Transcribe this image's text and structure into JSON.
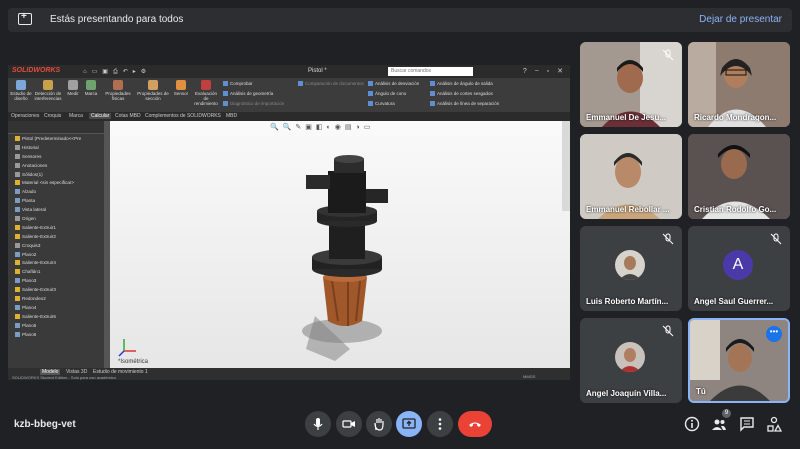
{
  "banner": {
    "text": "Estás presentando para todos",
    "stop_label": "Dejar de presentar"
  },
  "solidworks": {
    "logo": "SOLIDWORKS",
    "doc_title": "Pistol *",
    "search_placeholder": "Buscar comandos",
    "ribbon_large": [
      "Estudio de diseño",
      "Detección de interferencias",
      "Medir",
      "Marca",
      "Propiedades físicas",
      "Propiedades de sección",
      "Sensor",
      "Evaluación de rendimiento"
    ],
    "ribbon_small": [
      "Comprobar",
      "Análisis de geometría",
      "Diagnóstico de importación",
      "Comparación de documentos",
      "Análisis de desviación",
      "Ángulo de cono",
      "Curvatura",
      "Análisis de ángulo de salida",
      "Análisis de cortes sesgados",
      "Análisis de línea de separación"
    ],
    "tabs": [
      "Operaciones",
      "Croquis",
      "Marca",
      "Calcular",
      "Cotas MBD",
      "Complementos de SOLIDWORKS",
      "MBD"
    ],
    "active_tab": "Calcular",
    "tree": [
      {
        "label": "Pistol  (Predeterminado<<Pre",
        "icon": "part"
      },
      {
        "label": "Historial",
        "icon": "folder"
      },
      {
        "label": "Sensores",
        "icon": "folder"
      },
      {
        "label": "Anotaciones",
        "icon": "folder"
      },
      {
        "label": "Sólidos(1)",
        "icon": "folder"
      },
      {
        "label": "Material <sin especificar>",
        "icon": "material"
      },
      {
        "label": "Alzado",
        "icon": "plane"
      },
      {
        "label": "Planta",
        "icon": "plane"
      },
      {
        "label": "Vista lateral",
        "icon": "plane"
      },
      {
        "label": "Origen",
        "icon": "origin"
      },
      {
        "label": "Saliente-Extruir1",
        "icon": "feature"
      },
      {
        "label": "Saliente-Extruir2",
        "icon": "feature"
      },
      {
        "label": "Croquis3",
        "icon": "sketch"
      },
      {
        "label": "Plano2",
        "icon": "plane"
      },
      {
        "label": "Saliente-Extruir4",
        "icon": "feature"
      },
      {
        "label": "Chaflán1",
        "icon": "feature"
      },
      {
        "label": "Plano3",
        "icon": "plane"
      },
      {
        "label": "Saliente-Extruir3",
        "icon": "feature"
      },
      {
        "label": "Redondeo2",
        "icon": "feature"
      },
      {
        "label": "Plano4",
        "icon": "plane"
      },
      {
        "label": "Saliente-Extruir6",
        "icon": "feature"
      },
      {
        "label": "Plano5",
        "icon": "plane"
      },
      {
        "label": "Plano6",
        "icon": "plane"
      }
    ],
    "view_label": "*Isométrica",
    "bottom_tabs": [
      "Modelo",
      "Vistas 3D",
      "Estudio de movimiento 1"
    ],
    "status_text": "SOLIDWORKS Student Edition - Solo para uso académico",
    "units": "MMGS"
  },
  "participants": [
    {
      "name": "Emmanuel De Jesu...",
      "type": "video",
      "muted": false
    },
    {
      "name": "Ricardo Mondragon...",
      "type": "video",
      "muted": false
    },
    {
      "name": "Emmanuel Rebollar ...",
      "type": "video",
      "muted": false
    },
    {
      "name": "Cristian Rodolfo Go...",
      "type": "video",
      "muted": false
    },
    {
      "name": "Luis Roberto Martín...",
      "type": "avatar",
      "muted": true
    },
    {
      "name": "Angel Saul Guerrer...",
      "type": "letter",
      "letter": "A",
      "muted": true
    },
    {
      "name": "Angel Joaquín Villa...",
      "type": "avatar",
      "muted": true
    },
    {
      "name": "Tú",
      "type": "video",
      "muted": false
    }
  ],
  "meeting": {
    "code": "kzb-bbeg-vet",
    "people_count": "9"
  },
  "colors": {
    "background": "#202124",
    "accent": "#8ab4f8",
    "hangup": "#ea4335"
  }
}
